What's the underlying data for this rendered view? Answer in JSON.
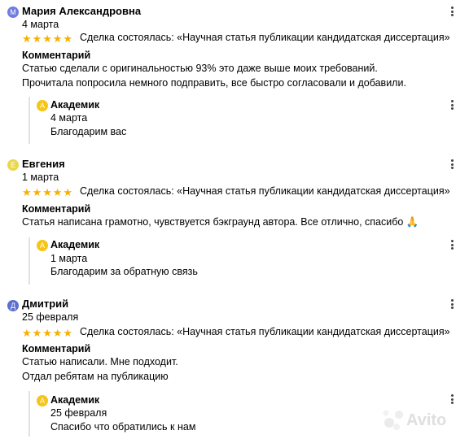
{
  "reviews": [
    {
      "avatar_letter": "М",
      "avatar_color": "#6f7ee0",
      "name": "Мария Александровна",
      "date": "4 марта",
      "rating": 5,
      "deal": "Сделка состоялась: «Научная статья публикации кандидатская диссертация»",
      "comment_label": "Комментарий",
      "comment_lines": [
        "Статью сделали с оригинальностью 93% это даже выше моих требований.",
        "Прочитала попросила немного подправить, все быстро согласовали и добавили."
      ],
      "reply": {
        "avatar_letter": "А",
        "avatar_color": "#f5c518",
        "name": "Академик",
        "date": "4 марта",
        "text": "Благодарим вас"
      }
    },
    {
      "avatar_letter": "Е",
      "avatar_color": "#e8d84a",
      "name": "Евгения",
      "date": "1 марта",
      "rating": 5,
      "deal": "Сделка состоялась: «Научная статья публикации кандидатская диссертация»",
      "comment_label": "Комментарий",
      "comment_lines": [
        "Статья написана грамотно, чувствуется бэкграунд автора. Все отлично, спасибо 🙏"
      ],
      "reply": {
        "avatar_letter": "А",
        "avatar_color": "#f5c518",
        "name": "Академик",
        "date": "1 марта",
        "text": "Благодарим за обратную связь"
      }
    },
    {
      "avatar_letter": "Д",
      "avatar_color": "#5b6fd0",
      "name": "Дмитрий",
      "date": "25 февраля",
      "rating": 5,
      "deal": "Сделка состоялась: «Научная статья публикации кандидатская диссертация»",
      "comment_label": "Комментарий",
      "comment_lines": [
        "Статью написали. Мне подходит.",
        "Отдал ребятам на публикацию"
      ],
      "reply": {
        "avatar_letter": "А",
        "avatar_color": "#f5c518",
        "name": "Академик",
        "date": "25 февраля",
        "text": "Спасибо что обратились к нам"
      }
    }
  ],
  "watermark": {
    "brand": "Avito"
  }
}
